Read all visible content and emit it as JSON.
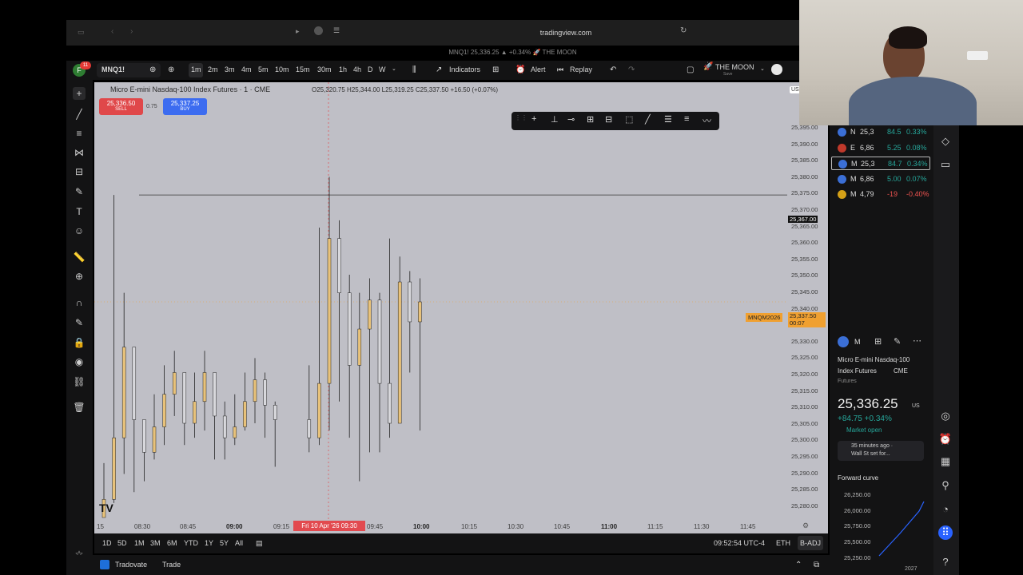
{
  "browser": {
    "url": "tradingview.com",
    "tab_title": "MNQ1! 25,336.25 ▲ +0.34% 🚀 THE MOON"
  },
  "toolbar": {
    "avatar_letter": "F",
    "avatar_badge": "11",
    "symbol": "MNQ1!",
    "intervals": [
      "1m",
      "2m",
      "3m",
      "4m",
      "5m",
      "10m",
      "15m",
      "30m",
      "1h",
      "4h",
      "D",
      "W"
    ],
    "active_interval": "1m",
    "indicators_label": "Indicators",
    "alert_label": "Alert",
    "replay_label": "Replay",
    "layout_name": "THE MOON",
    "layout_sub": "Save"
  },
  "chart": {
    "title": "Micro E-mini Nasdaq-100 Index Futures · 1 · CME",
    "ohlc": "O25,320.75 H25,344.00 L25,319.25 C25,337.50 +16.50 (+0.07%)",
    "sell_price": "25,336.50",
    "sell_label": "SELL",
    "buy_price": "25,337.25",
    "buy_label": "BUY",
    "spread": "0.75",
    "currency": "USD",
    "hline_price": "25,367.00",
    "contract_label": "MNQM2026",
    "last_price": "25,337.50",
    "countdown": "00:07",
    "crosshair_time": "Fri 10 Apr '26  09:30"
  },
  "price_ticks": [
    "25,395.00",
    "25,390.00",
    "25,385.00",
    "25,380.00",
    "25,375.00",
    "25,370.00",
    "25,365.00",
    "25,360.00",
    "25,355.00",
    "25,350.00",
    "25,345.00",
    "25,340.00",
    "25,335.00",
    "25,330.00",
    "25,325.00",
    "25,320.00",
    "25,315.00",
    "25,310.00",
    "25,305.00",
    "25,300.00",
    "25,295.00",
    "25,290.00",
    "25,285.00",
    "25,280.00"
  ],
  "time_ticks": [
    {
      "label": "15",
      "bold": false
    },
    {
      "label": "08:30",
      "bold": false
    },
    {
      "label": "08:45",
      "bold": false
    },
    {
      "label": "09:00",
      "bold": true
    },
    {
      "label": "09:15",
      "bold": false
    },
    {
      "label": "09:45",
      "bold": false
    },
    {
      "label": "10:00",
      "bold": true
    },
    {
      "label": "10:15",
      "bold": false
    },
    {
      "label": "10:30",
      "bold": false
    },
    {
      "label": "10:45",
      "bold": false
    },
    {
      "label": "11:00",
      "bold": true
    },
    {
      "label": "11:15",
      "bold": false
    },
    {
      "label": "11:30",
      "bold": false
    },
    {
      "label": "11:45",
      "bold": false
    }
  ],
  "ranges": [
    "1D",
    "5D",
    "1M",
    "3M",
    "6M",
    "YTD",
    "1Y",
    "5Y",
    "All"
  ],
  "clock": "09:52:54 UTC-4",
  "session": "ETH",
  "adj": "B-ADJ",
  "status": {
    "broker": "Tradovate",
    "trade": "Trade"
  },
  "watchlist": [
    {
      "sym": "N",
      "last": "25,3",
      "chg": "84.5",
      "pct": "0.33%",
      "color": "#26a69a",
      "flag": "#3b6fd6"
    },
    {
      "sym": "E",
      "last": "6,86",
      "chg": "5.25",
      "pct": "0.08%",
      "color": "#26a69a",
      "flag": "#c0392b"
    },
    {
      "sym": "M",
      "last": "25,3",
      "chg": "84.7",
      "pct": "0.34%",
      "color": "#26a69a",
      "flag": "#3b6fd6"
    },
    {
      "sym": "M",
      "last": "6,86",
      "chg": "5.00",
      "pct": "0.07%",
      "color": "#26a69a",
      "flag": "#3b6fd6"
    },
    {
      "sym": "M",
      "last": "4,79",
      "chg": "-19",
      "pct": "-0.40%",
      "color": "#ef5350",
      "flag": "#d4a017"
    }
  ],
  "details": {
    "sym": "M",
    "name_line1": "Micro E-mini Nasdaq-100",
    "name_line2": "Index Futures",
    "exchange": "CME",
    "type": "Futures",
    "price_main": "25,336",
    "price_tail": ".25",
    "currency": "US",
    "change": "+84.75 +0.34%",
    "market_status": "Market open",
    "news_time": "35 minutes ago ·",
    "news_text": "Wall St set for...",
    "forward_curve_title": "Forward curve",
    "fc_ticks": [
      "26,250.00",
      "26,000.00",
      "25,750.00",
      "25,500.00",
      "25,250.00"
    ],
    "fc_year": "2027"
  },
  "chart_data": {
    "type": "candlestick",
    "x_times": [
      "08:24",
      "08:27",
      "08:30",
      "08:33",
      "08:36",
      "08:39",
      "08:42",
      "08:45",
      "08:48",
      "08:51",
      "08:54",
      "08:57",
      "09:00",
      "09:03",
      "09:06",
      "09:09",
      "09:12",
      "09:15",
      "09:18",
      "09:21",
      "09:24",
      "09:27",
      "09:30",
      "09:33",
      "09:36",
      "09:39",
      "09:42",
      "09:45",
      "09:48",
      "09:51"
    ],
    "close": [
      25283,
      25300,
      25325,
      25305,
      25296,
      25303,
      25312,
      25318,
      25304,
      25310,
      25318,
      25306,
      25300,
      25303,
      25310,
      25316,
      25309,
      25305,
      25300,
      25315,
      25355,
      25340,
      25320,
      25330,
      25338,
      25315,
      25304,
      25343,
      25332,
      25337.5
    ],
    "high": [
      25293,
      25367,
      25340,
      25312,
      25305,
      25312,
      25320,
      25324,
      25313,
      25318,
      25324,
      25315,
      25310,
      25312,
      25318,
      25322,
      25318,
      25310,
      25320,
      25358,
      25372,
      25360,
      25345,
      25340,
      25344,
      25340,
      25355,
      25350,
      25346,
      25344
    ],
    "low": [
      25278,
      25282,
      25290,
      25285,
      25288,
      25294,
      25298,
      25306,
      25298,
      25300,
      25302,
      25294,
      25294,
      25298,
      25302,
      25304,
      25300,
      25292,
      25296,
      25298,
      25302,
      25310,
      25300,
      25288,
      25296,
      25296,
      25300,
      25310,
      25318,
      25302
    ],
    "ylim": [
      25278,
      25397
    ]
  }
}
